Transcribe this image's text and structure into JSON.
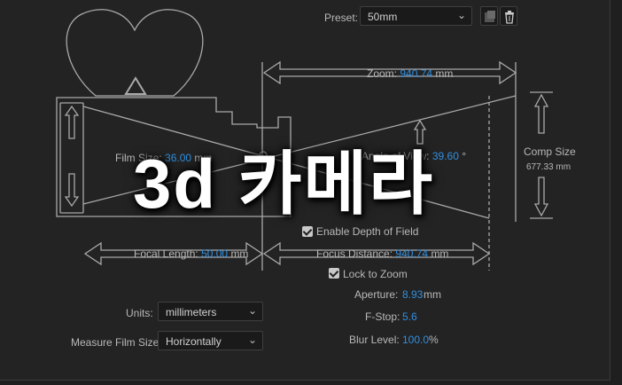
{
  "preset": {
    "label": "Preset:",
    "value": "50mm"
  },
  "zoom": {
    "label": "Zoom:",
    "value": "940.74",
    "unit": "mm"
  },
  "film_size": {
    "label": "Film Size:",
    "value": "36.00",
    "unit": "mm"
  },
  "angle_of_view": {
    "label": "Angle of View:",
    "value": "39.60",
    "unit": "°"
  },
  "comp_size": {
    "label": "Comp Size",
    "value": "677.33 mm"
  },
  "focal_length": {
    "label": "Focal Length:",
    "value": "50.00",
    "unit": "mm"
  },
  "enable_dof": {
    "label": "Enable Depth of Field",
    "checked": true
  },
  "focus_distance": {
    "label": "Focus Distance:",
    "value": "940.74",
    "unit": "mm"
  },
  "lock_to_zoom": {
    "label": "Lock to Zoom",
    "checked": true
  },
  "aperture": {
    "label": "Aperture:",
    "value": "8.93",
    "unit": "mm"
  },
  "fstop": {
    "label": "F-Stop:",
    "value": "5.6"
  },
  "blur_level": {
    "label": "Blur Level:",
    "value": "100.0",
    "unit": "%"
  },
  "units": {
    "label": "Units:",
    "value": "millimeters"
  },
  "measure_film_size": {
    "label": "Measure Film Size:",
    "value": "Horizontally"
  },
  "overlay_title": "3d 카메라",
  "icons": [
    "chevron-down-icon",
    "save-preset-icon",
    "trash-icon",
    "camera-diagram"
  ],
  "colors": {
    "accent": "#2f8fe0",
    "background": "#232323",
    "line": "#a9a9a9"
  }
}
